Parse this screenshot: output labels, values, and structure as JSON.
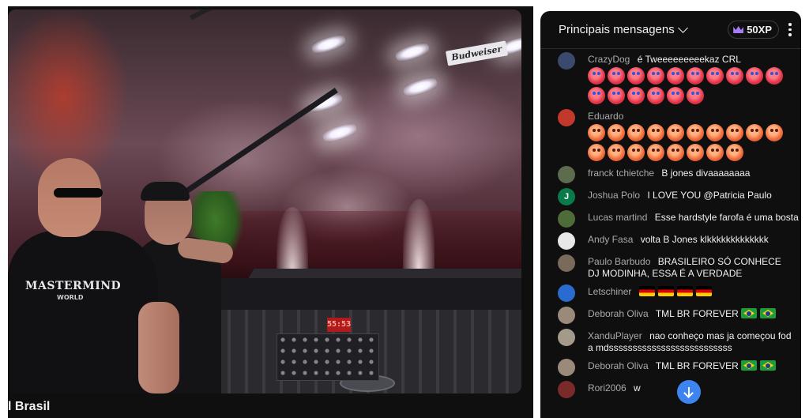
{
  "video": {
    "title_partial": "l Brasil",
    "stage_brand": "Budweiser",
    "shirt_logo": "MASTERMIND",
    "shirt_sub": "WORLD",
    "deck_display": "55:53"
  },
  "chat": {
    "header_title": "Principais mensagens",
    "xp_badge": "50XP",
    "messages": [
      {
        "author": "CrazyDog",
        "text": "é Tweeeeeeeeekaz CRL",
        "avatar_color": "#3a4a6e"
      },
      {
        "author": "Eduardo",
        "text": "",
        "avatar_color": "#c0392b"
      },
      {
        "author": "franck tchietche",
        "text": "B jones divaaaaaaaa",
        "avatar_color": "#5d6b4f"
      },
      {
        "author": "Joshua Polo",
        "text": "I LOVE YOU @Patricia Paulo",
        "avatar_color": "#0b7a4b",
        "initial": "J"
      },
      {
        "author": "Lucas martind",
        "text": "Esse hardstyle farofa é uma bosta",
        "avatar_color": "#4e6b3a"
      },
      {
        "author": "Andy Fasa",
        "text": "volta B Jones klkkkkkkkkkkkkk",
        "avatar_color": "#e8e8e8"
      },
      {
        "author": "Paulo Barbudo",
        "text": "BRASILEIRO SÓ CONHECE DJ MODINHA, ESSA É A VERDADE",
        "avatar_color": "#7a6a5a"
      },
      {
        "author": "Letschiner",
        "text": "",
        "avatar_color": "#2a6bd1"
      },
      {
        "author": "Deborah Oliva",
        "text": "TML BR FOREVER",
        "avatar_color": "#9a8a7a"
      },
      {
        "author": "XanduPlayer",
        "text": "nao conheço mas ja começou foda mdssssssssssssssssssssssssss",
        "avatar_color": "#a39a8a"
      },
      {
        "author": "Deborah Oliva",
        "text": "TML BR FOREVER",
        "avatar_color": "#9a8a7a"
      },
      {
        "author": "Rori2006",
        "text": "w",
        "avatar_color": "#7a2a2a"
      }
    ]
  },
  "colors": {
    "chat_bg": "#0f0f0f",
    "author_gray": "#aaaaaa",
    "accent_blue": "#3e84f0",
    "xp_crown": "#a97cf7"
  },
  "icons": {
    "chevron": "chevron-down-icon",
    "more": "more-vert-icon",
    "crown": "crown-icon",
    "scroll": "arrow-down-icon"
  }
}
